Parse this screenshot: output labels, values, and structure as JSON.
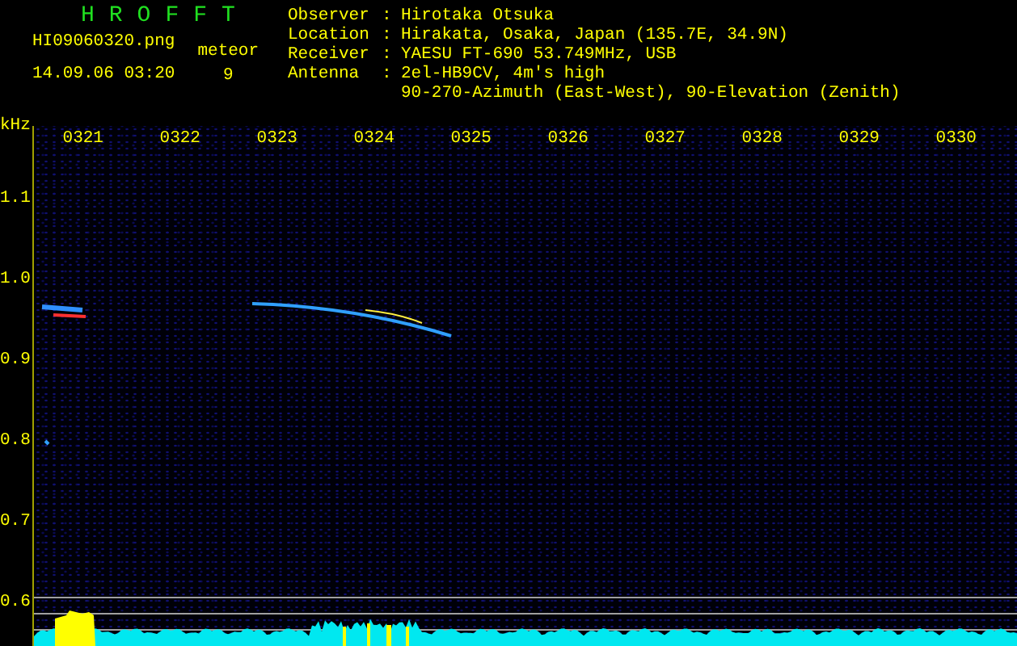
{
  "header": {
    "title": "HROFFT",
    "filename": "HI09060320.png",
    "timestamp": "14.09.06 03:20",
    "count_label": "meteor",
    "count": "9"
  },
  "station_info": [
    {
      "label": "Observer",
      "separator": ":",
      "value": "Hirotaka Otsuka"
    },
    {
      "label": "Location",
      "separator": ":",
      "value": "Hirakata, Osaka, Japan (135.7E, 34.9N)"
    },
    {
      "label": "Receiver",
      "separator": ":",
      "value": "YAESU FT-690 53.749MHz, USB"
    },
    {
      "label": "Antenna",
      "separator": ":",
      "value": "2el-HB9CV, 4m's high"
    },
    {
      "value": "90-270-Azimuth (East-West), 90-Elevation (Zenith)"
    }
  ],
  "plot": {
    "unit": "kHz",
    "time_labels": [
      "0321",
      "0322",
      "0323",
      "0324",
      "0325",
      "0326",
      "0327",
      "0328",
      "0329",
      "0330"
    ],
    "freq_labels": [
      "1.1",
      "1.0",
      "0.9",
      "0.8",
      "0.7",
      "0.6"
    ]
  }
}
